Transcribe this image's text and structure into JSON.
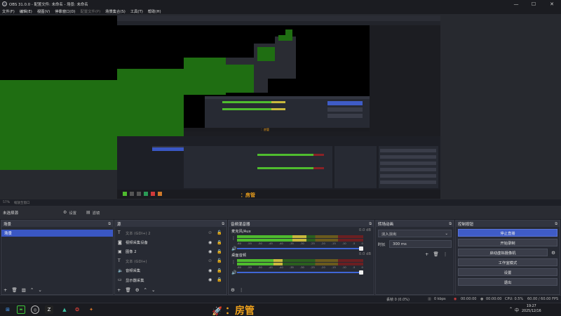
{
  "window": {
    "title": "OBS 31.0.0 - 配置文件: 未命名 - 场景: 未命名",
    "minimize": "—",
    "maximize": "☐",
    "close": "✕"
  },
  "menu": [
    "文件(F)",
    "编辑(E)",
    "视图(V)",
    "停靠窗口(D)",
    "配置文件(P)",
    "场景集合(S)",
    "工具(T)",
    "帮助(H)"
  ],
  "preview": {
    "zoom_text": "57%",
    "zoom_hint": "缩放至窗口",
    "accent_green": "#1f6e12"
  },
  "source_toolbar": {
    "no_selection": "未选择源",
    "settings_label": "设置",
    "filters_label": "滤镜"
  },
  "scenes": {
    "title": "场景",
    "items": [
      "场景"
    ]
  },
  "sources": {
    "title": "源",
    "items": [
      {
        "icon": "text-icon",
        "label": "文本 (GDI+) 2",
        "dim": true
      },
      {
        "icon": "camera-icon",
        "label": "视频采集设备",
        "dim": false
      },
      {
        "icon": "image-icon",
        "label": "图像 2",
        "dim": false
      },
      {
        "icon": "text-icon",
        "label": "文本 (GDI+)",
        "dim": true
      },
      {
        "icon": "speaker-icon",
        "label": "音频采集",
        "dim": false
      },
      {
        "icon": "monitor-icon",
        "label": "显示器采集",
        "dim": false
      }
    ]
  },
  "mixer": {
    "title": "音频混音器",
    "channels": [
      {
        "name": "麦克风/Aux",
        "db": "0.0 dB",
        "level1": 0.55,
        "level2": 0.55,
        "volume": 1.0
      },
      {
        "name": "桌面音频",
        "db": "0.0 dB",
        "level1": 0.36,
        "level2": 0.36,
        "volume": 1.0
      }
    ],
    "scale": [
      "-60",
      "-55",
      "-50",
      "-45",
      "-40",
      "-35",
      "-30",
      "-25",
      "-20",
      "-15",
      "-10",
      "-5",
      "0"
    ]
  },
  "transitions": {
    "title": "转场动画",
    "selected": "淡入淡出",
    "duration_label": "时长",
    "duration_value": "300 ms"
  },
  "controls": {
    "title": "控制按钮",
    "stop_stream": "停止直播",
    "start_record": "开始录制",
    "virtual_cam": "启动虚拟摄像机",
    "studio_mode": "工作室模式",
    "settings": "设置",
    "exit": "退出"
  },
  "status": {
    "dropped": "丢帧 0 (0.0%)",
    "kbps": "0 kbps",
    "stream_time": "00:00:00",
    "rec_time": "00:00:00",
    "cpu": "CPU: 0.5%",
    "fps": "60.00 / 60.00 FPS"
  },
  "taskbar": {
    "banner_text": "：房管",
    "time": "19:27",
    "date": "2025/12/16",
    "lang": "中"
  }
}
